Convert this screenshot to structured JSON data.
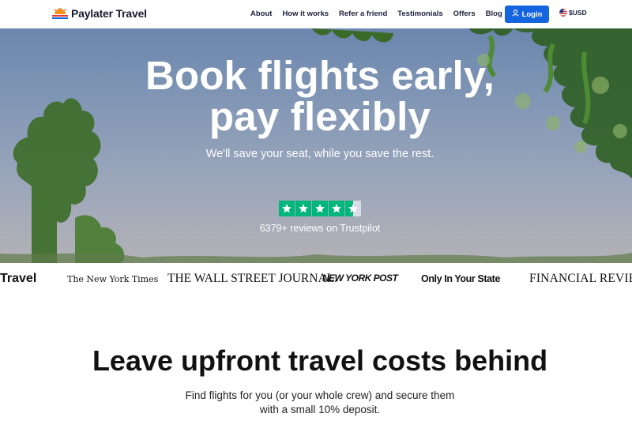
{
  "header": {
    "logo_text": "Paylater Travel",
    "nav": [
      "About",
      "How it works",
      "Refer a friend",
      "Testimonials",
      "Offers",
      "Blog"
    ],
    "login_label": "Login",
    "currency_label": "$USD"
  },
  "hero": {
    "title_line1": "Book flights early,",
    "title_line2": "pay flexibly",
    "subtitle": "We'll save your seat, while you save the rest.",
    "rating_stars": 4.5,
    "reviews_text": "6379+ reviews on Trustpilot"
  },
  "press": {
    "logos": [
      "Travel",
      "The New York Times",
      "THE WALL STREET JOURNAL.",
      "NEW YORK POST",
      "Only In Your State",
      "FINANCIAL REVIEW"
    ]
  },
  "section": {
    "title": "Leave upfront travel costs behind",
    "body": "Find flights for you (or your whole crew) and secure them with a small 10% deposit."
  },
  "colors": {
    "brand_blue": "#1565e0",
    "trustpilot_green": "#00b67a"
  }
}
